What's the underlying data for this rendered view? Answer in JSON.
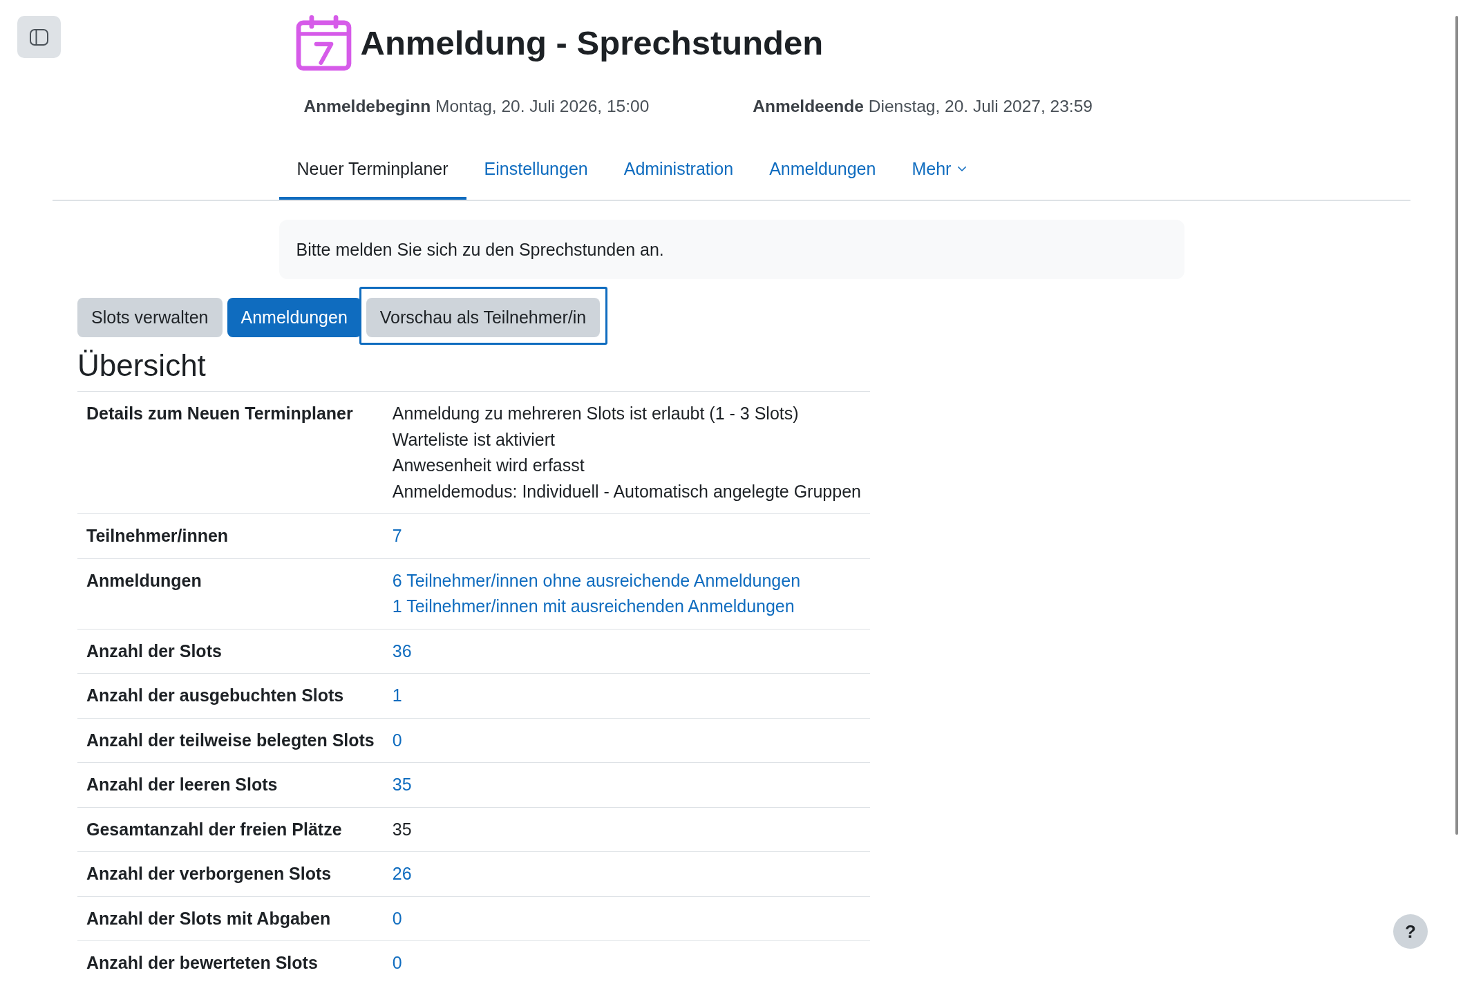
{
  "header": {
    "title": "Anmeldung - Sprechstunden"
  },
  "dates": [
    {
      "label": "Anmeldebeginn",
      "value": "Montag, 20. Juli 2026, 15:00"
    },
    {
      "label": "Anmeldeende",
      "value": "Dienstag, 20. Juli 2027, 23:59"
    }
  ],
  "tabs": [
    {
      "label": "Neuer Terminplaner",
      "selected": true,
      "kind": "link"
    },
    {
      "label": "Einstellungen",
      "selected": false,
      "kind": "link"
    },
    {
      "label": "Administration",
      "selected": false,
      "kind": "link"
    },
    {
      "label": "Anmeldungen",
      "selected": false,
      "kind": "link"
    },
    {
      "label": "Mehr",
      "selected": false,
      "kind": "menu"
    }
  ],
  "notice": "Bitte melden Sie sich zu den Sprechstunden an.",
  "buttons": [
    {
      "label": "Slots verwalten",
      "selected": false,
      "focused": false
    },
    {
      "label": "Anmeldungen",
      "selected": true,
      "focused": false
    },
    {
      "label": "Vorschau als Teilnehmer/in",
      "selected": false,
      "focused": true
    }
  ],
  "overview": {
    "title": "Übersicht",
    "rows": [
      {
        "label": "Details zum Neuen Terminplaner",
        "values": [
          {
            "text": "Anmeldung zu mehreren Slots ist erlaubt (1 - 3 Slots)",
            "kind": "text"
          },
          {
            "text": "Warteliste ist aktiviert",
            "kind": "text"
          },
          {
            "text": "Anwesenheit wird erfasst",
            "kind": "text"
          },
          {
            "text": "Anmeldemodus: Individuell - Automatisch angelegte Gruppen",
            "kind": "text"
          }
        ]
      },
      {
        "label": "Teilnehmer/innen",
        "values": [
          {
            "text": "7",
            "kind": "link"
          }
        ]
      },
      {
        "label": "Anmeldungen",
        "values": [
          {
            "text": "6 Teilnehmer/innen ohne ausreichende Anmeldungen",
            "kind": "link"
          },
          {
            "text": "1 Teilnehmer/innen mit ausreichenden Anmeldungen",
            "kind": "link"
          }
        ]
      },
      {
        "label": "Anzahl der Slots",
        "values": [
          {
            "text": "36",
            "kind": "link"
          }
        ]
      },
      {
        "label": "Anzahl der ausgebuchten Slots",
        "values": [
          {
            "text": "1",
            "kind": "link"
          }
        ]
      },
      {
        "label": "Anzahl der teilweise belegten Slots",
        "values": [
          {
            "text": "0",
            "kind": "link"
          }
        ]
      },
      {
        "label": "Anzahl der leeren Slots",
        "values": [
          {
            "text": "35",
            "kind": "link"
          }
        ]
      },
      {
        "label": "Gesamtanzahl der freien Plätze",
        "values": [
          {
            "text": "35",
            "kind": "text"
          }
        ]
      },
      {
        "label": "Anzahl der verborgenen Slots",
        "values": [
          {
            "text": "26",
            "kind": "link"
          }
        ]
      },
      {
        "label": "Anzahl der Slots mit Abgaben",
        "values": [
          {
            "text": "0",
            "kind": "link"
          }
        ]
      },
      {
        "label": "Anzahl der bewerteten Slots",
        "values": [
          {
            "text": "0",
            "kind": "link"
          }
        ]
      }
    ]
  },
  "help_button": {
    "label": "?"
  }
}
